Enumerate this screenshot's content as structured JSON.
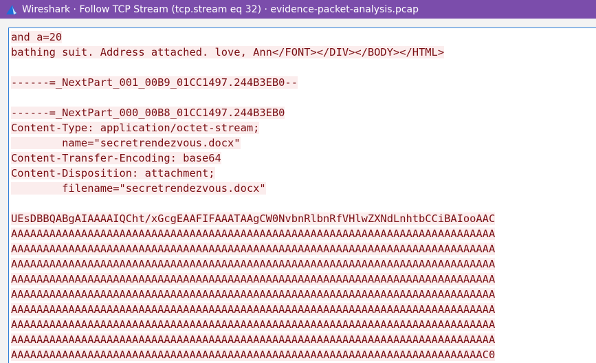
{
  "window": {
    "title": "Wireshark · Follow TCP Stream (tcp.stream eq 32) · evidence-packet-analysis.pcap",
    "icon": "wireshark-fin-icon",
    "titlebar_color": "#7b4dab"
  },
  "stream": {
    "text_color": "#7a0f14",
    "highlight_color": "#fbeded",
    "lines": [
      "and a=20",
      "bathing suit. Address attached. love, Ann</FONT></DIV></BODY></HTML>",
      "",
      "------=_NextPart_001_00B9_01CC1497.244B3EB0--",
      "",
      "------=_NextPart_000_00B8_01CC1497.244B3EB0",
      "Content-Type: application/octet-stream;",
      "        name=\"secretrendezvous.docx\"",
      "Content-Transfer-Encoding: base64",
      "Content-Disposition: attachment;",
      "        filename=\"secretrendezvous.docx\"",
      "",
      "UEsDBBQABgAIAAAAIQCht/xGcgEAAFIFAAATAAgCW0NvbnRlbnRfVHlwZXNdLnhtbCCiBAIooAAC",
      "AAAAAAAAAAAAAAAAAAAAAAAAAAAAAAAAAAAAAAAAAAAAAAAAAAAAAAAAAAAAAAAAAAAAAAAAAAAA",
      "AAAAAAAAAAAAAAAAAAAAAAAAAAAAAAAAAAAAAAAAAAAAAAAAAAAAAAAAAAAAAAAAAAAAAAAAAAAA",
      "AAAAAAAAAAAAAAAAAAAAAAAAAAAAAAAAAAAAAAAAAAAAAAAAAAAAAAAAAAAAAAAAAAAAAAAAAAAA",
      "AAAAAAAAAAAAAAAAAAAAAAAAAAAAAAAAAAAAAAAAAAAAAAAAAAAAAAAAAAAAAAAAAAAAAAAAAAAA",
      "AAAAAAAAAAAAAAAAAAAAAAAAAAAAAAAAAAAAAAAAAAAAAAAAAAAAAAAAAAAAAAAAAAAAAAAAAAAA",
      "AAAAAAAAAAAAAAAAAAAAAAAAAAAAAAAAAAAAAAAAAAAAAAAAAAAAAAAAAAAAAAAAAAAAAAAAAAAA",
      "AAAAAAAAAAAAAAAAAAAAAAAAAAAAAAAAAAAAAAAAAAAAAAAAAAAAAAAAAAAAAAAAAAAAAAAAAAAA",
      "AAAAAAAAAAAAAAAAAAAAAAAAAAAAAAAAAAAAAAAAAAAAAAAAAAAAAAAAAAAAAAAAAAAAAAAAAAAA",
      "AAAAAAAAAAAAAAAAAAAAAAAAAAAAAAAAAAAAAAAAAAAAAAAAAAAAAAAAAAAAAAAAAAAAAAAAAAC0"
    ]
  }
}
